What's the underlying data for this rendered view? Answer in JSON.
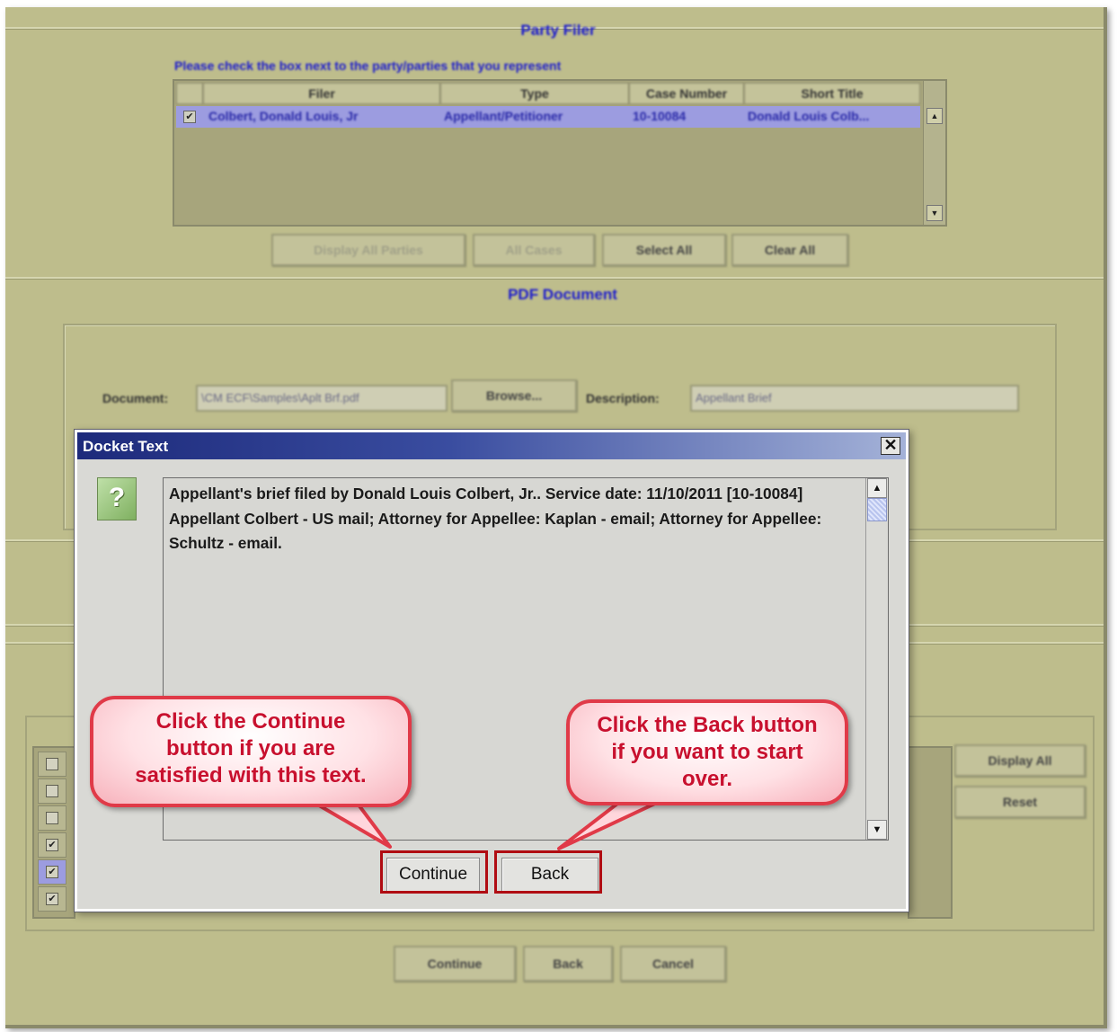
{
  "party_filer": {
    "title": "Party Filer",
    "hint": "Please check the box next to the party/parties that you represent",
    "columns": [
      "Filer",
      "Type",
      "Case Number",
      "Short Title"
    ],
    "row": {
      "checked": "✔",
      "filer": "Colbert, Donald Louis, Jr",
      "type": "Appellant/Petitioner",
      "case_number": "10-10084",
      "short_title": "Donald Louis Colb..."
    },
    "buttons": {
      "display_all_parties": "Display All Parties",
      "all_cases": "All Cases",
      "select_all": "Select All",
      "clear_all": "Clear All"
    }
  },
  "pdf_document": {
    "title": "PDF Document",
    "document_label": "Document:",
    "document_value": "\\CM ECF\\Samples\\Aplt Brf.pdf",
    "browse_label": "Browse...",
    "description_label": "Description:",
    "description_value": "Appellant Brief"
  },
  "lower": {
    "display_all": "Display All",
    "reset": "Reset",
    "checkboxes": [
      "",
      "",
      "",
      "✔",
      "✔",
      "✔"
    ]
  },
  "footer": {
    "continue": "Continue",
    "back": "Back",
    "cancel": "Cancel"
  },
  "dialog": {
    "title": "Docket Text",
    "close": "✕",
    "text": "Appellant's brief filed by Donald Louis Colbert, Jr.. Service date: 11/10/2011 [10-10084] Appellant Colbert - US mail; Attorney for Appellee: Kaplan - email; Attorney for Appellee: Schultz - email.",
    "continue_label": "Continue",
    "back_label": "Back"
  },
  "callouts": {
    "continue_text": "Click the Continue button if you are satisfied with this text.",
    "back_text": "Click the Back button if you want to start over."
  },
  "colors": {
    "callout_text": "#c8102e",
    "callout_border": "#e03a48",
    "highlight": "#b00c12",
    "titlebar": "#1d2a7b"
  }
}
